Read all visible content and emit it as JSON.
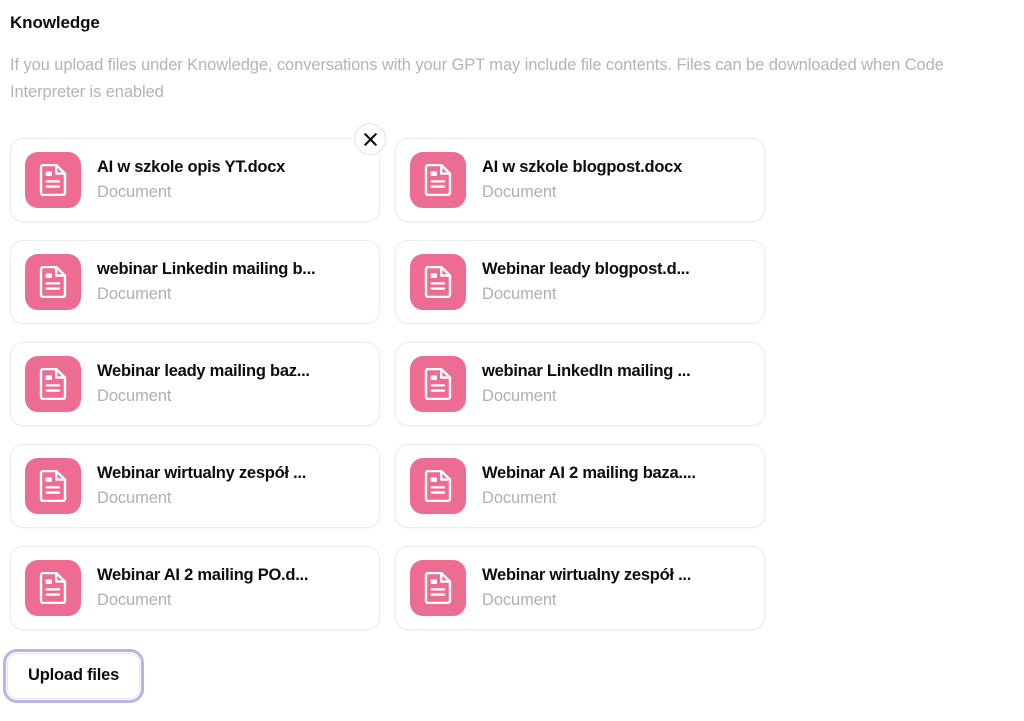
{
  "section": {
    "title": "Knowledge",
    "description": "If you upload files under Knowledge, conversations with your GPT may include file contents. Files can be downloaded when Code Interpreter is enabled"
  },
  "icons": {
    "document": "document-icon",
    "close": "close-icon"
  },
  "colors": {
    "icon_background": "#ec6c92",
    "title_text": "#0d0d0d",
    "muted_text": "#b4b4b4",
    "card_border": "#ececec",
    "focus_ring": "#b3b7e2"
  },
  "files": [
    {
      "name": "AI w szkole opis YT.docx",
      "type": "Document",
      "removable": true
    },
    {
      "name": "AI w szkole blogpost.docx",
      "type": "Document",
      "removable": false
    },
    {
      "name": "webinar Linkedin mailing b...",
      "type": "Document",
      "removable": false
    },
    {
      "name": "Webinar leady blogpost.d...",
      "type": "Document",
      "removable": false
    },
    {
      "name": "Webinar leady mailing baz...",
      "type": "Document",
      "removable": false
    },
    {
      "name": "webinar LinkedIn mailing ...",
      "type": "Document",
      "removable": false
    },
    {
      "name": "Webinar wirtualny zespół ...",
      "type": "Document",
      "removable": false
    },
    {
      "name": "Webinar AI 2 mailing baza....",
      "type": "Document",
      "removable": false
    },
    {
      "name": "Webinar AI 2 mailing PO.d...",
      "type": "Document",
      "removable": false
    },
    {
      "name": "Webinar wirtualny zespół ...",
      "type": "Document",
      "removable": false
    }
  ],
  "actions": {
    "upload_label": "Upload files"
  }
}
